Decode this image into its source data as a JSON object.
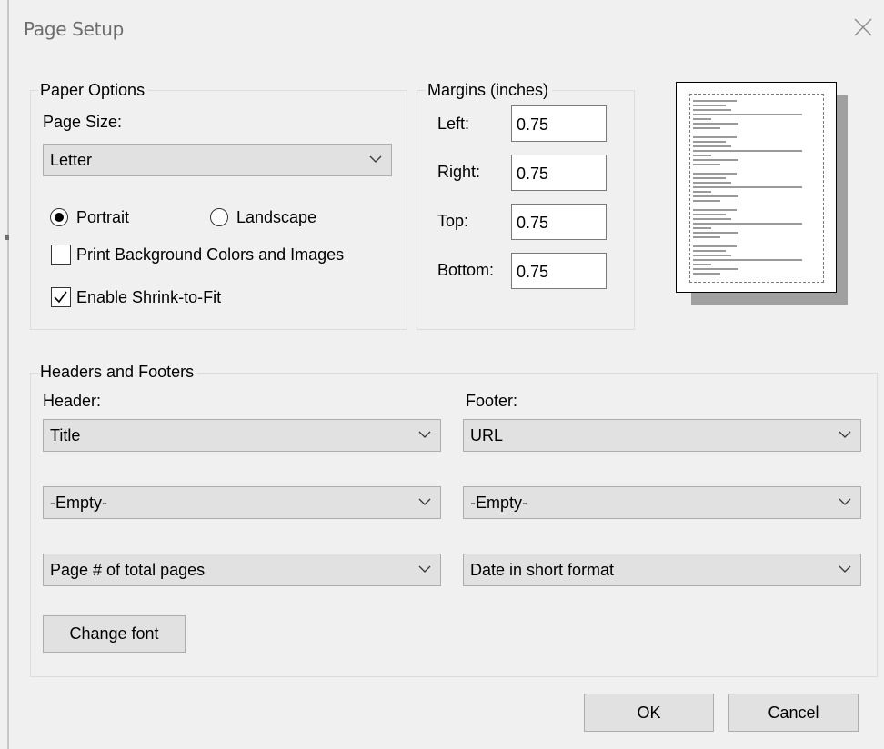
{
  "dialog": {
    "title": "Page Setup",
    "close_icon": "close-icon"
  },
  "paper_options": {
    "legend": "Paper Options",
    "page_size_label": "Page Size:",
    "page_size_value": "Letter",
    "orientation": {
      "portrait_label": "Portrait",
      "landscape_label": "Landscape",
      "selected": "Portrait"
    },
    "print_background_label": "Print Background Colors and Images",
    "print_background_checked": false,
    "shrink_to_fit_label": "Enable Shrink-to-Fit",
    "shrink_to_fit_checked": true
  },
  "margins": {
    "legend": "Margins (inches)",
    "left_label": "Left:",
    "left_value": "0.75",
    "right_label": "Right:",
    "right_value": "0.75",
    "top_label": "Top:",
    "top_value": "0.75",
    "bottom_label": "Bottom:",
    "bottom_value": "0.75"
  },
  "headers_footers": {
    "legend": "Headers and Footers",
    "header_label": "Header:",
    "footer_label": "Footer:",
    "header_1": "Title",
    "header_2": "-Empty-",
    "header_3": "Page # of total pages",
    "footer_1": "URL",
    "footer_2": "-Empty-",
    "footer_3": "Date in short format",
    "change_font_label": "Change font"
  },
  "buttons": {
    "ok_label": "OK",
    "cancel_label": "Cancel"
  },
  "colors": {
    "dialog_background": "#f0f0f0",
    "button_face": "#e1e1e1",
    "button_border": "#adadad",
    "group_border": "#dcdcdc",
    "title_text": "#6d6d6d"
  }
}
